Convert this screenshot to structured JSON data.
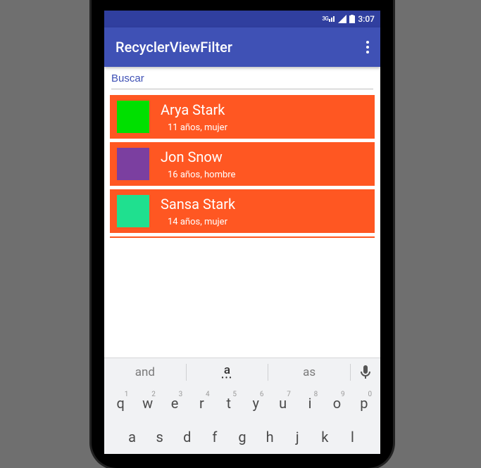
{
  "status": {
    "net_label": "3G",
    "time": "3:07"
  },
  "appbar": {
    "title": "RecyclerViewFilter"
  },
  "search": {
    "placeholder": "Buscar",
    "value": ""
  },
  "items": [
    {
      "name": "Arya Stark",
      "subtitle": "11 años, mujer",
      "color": "#00e000"
    },
    {
      "name": "Jon Snow",
      "subtitle": "16 años, hombre",
      "color": "#7b3fa0"
    },
    {
      "name": "Sansa Stark",
      "subtitle": "14 años, mujer",
      "color": "#1fe08f"
    }
  ],
  "keyboard": {
    "suggestions": [
      "and",
      "a",
      "as"
    ],
    "row1": [
      {
        "k": "q",
        "n": "1"
      },
      {
        "k": "w",
        "n": "2"
      },
      {
        "k": "e",
        "n": "3"
      },
      {
        "k": "r",
        "n": "4"
      },
      {
        "k": "t",
        "n": "5"
      },
      {
        "k": "y",
        "n": "6"
      },
      {
        "k": "u",
        "n": "7"
      },
      {
        "k": "i",
        "n": "8"
      },
      {
        "k": "o",
        "n": "9"
      },
      {
        "k": "p",
        "n": "0"
      }
    ],
    "row2": [
      "a",
      "s",
      "d",
      "f",
      "g",
      "h",
      "j",
      "k",
      "l"
    ]
  }
}
